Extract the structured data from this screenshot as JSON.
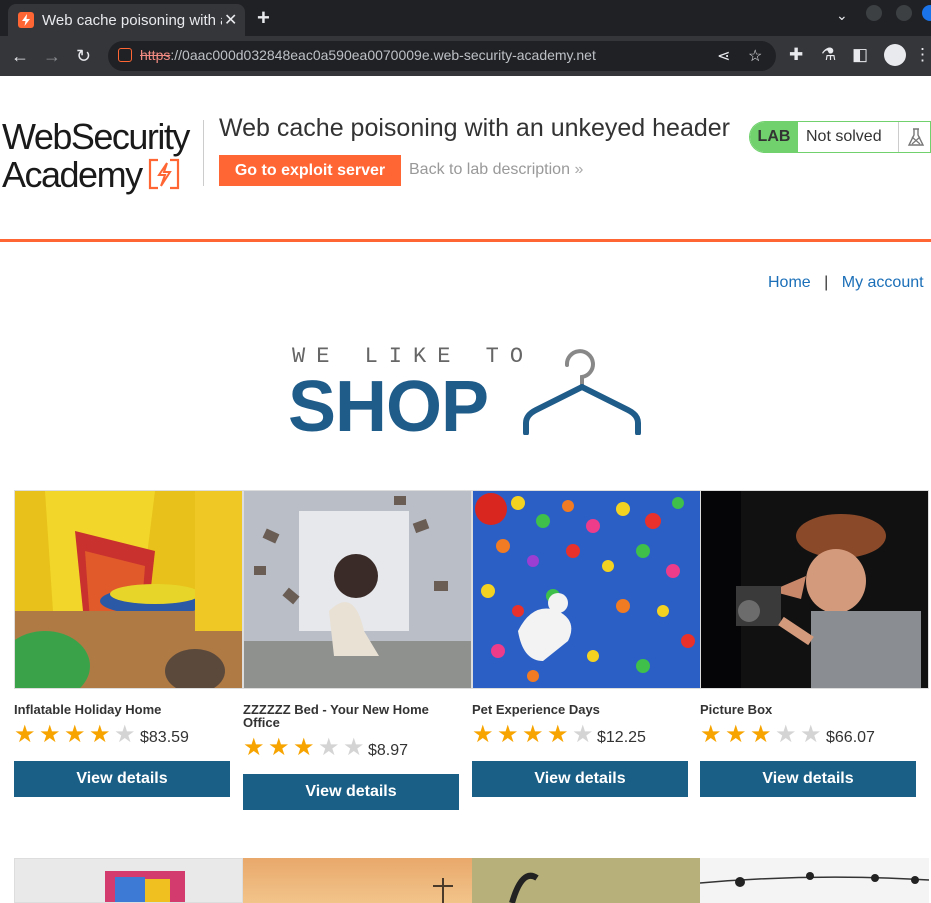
{
  "browser": {
    "tab_title": "Web cache poisoning with an unkeyed header",
    "url_scheme": "https",
    "url_rest": "://0aac000d032848eac0a590ea0070009e.web-security-academy.net"
  },
  "header": {
    "logo_line1": "WebSecurity",
    "logo_line2": "Academy",
    "lab_title": "Web cache poisoning with an unkeyed header",
    "exploit_button": "Go to exploit server",
    "back_link": "Back to lab description",
    "lab_badge": "LAB",
    "status": "Not solved"
  },
  "nav": {
    "home": "Home",
    "separator": "|",
    "account": "My account"
  },
  "banner": {
    "top": "WE LIKE TO",
    "word": "SHOP"
  },
  "products": [
    {
      "name": "Inflatable Holiday Home",
      "rating": 4,
      "price": "$83.59",
      "button": "View details"
    },
    {
      "name": "ZZZZZZ Bed - Your New Home Office",
      "rating": 3,
      "price": "$8.97",
      "button": "View details"
    },
    {
      "name": "Pet Experience Days",
      "rating": 4,
      "price": "$12.25",
      "button": "View details"
    },
    {
      "name": "Picture Box",
      "rating": 3,
      "price": "$66.07",
      "button": "View details"
    }
  ],
  "colors": {
    "accent": "#ff6633",
    "button": "#1a5f85",
    "star": "#f7a400",
    "solved_badge": "#70d16d"
  }
}
